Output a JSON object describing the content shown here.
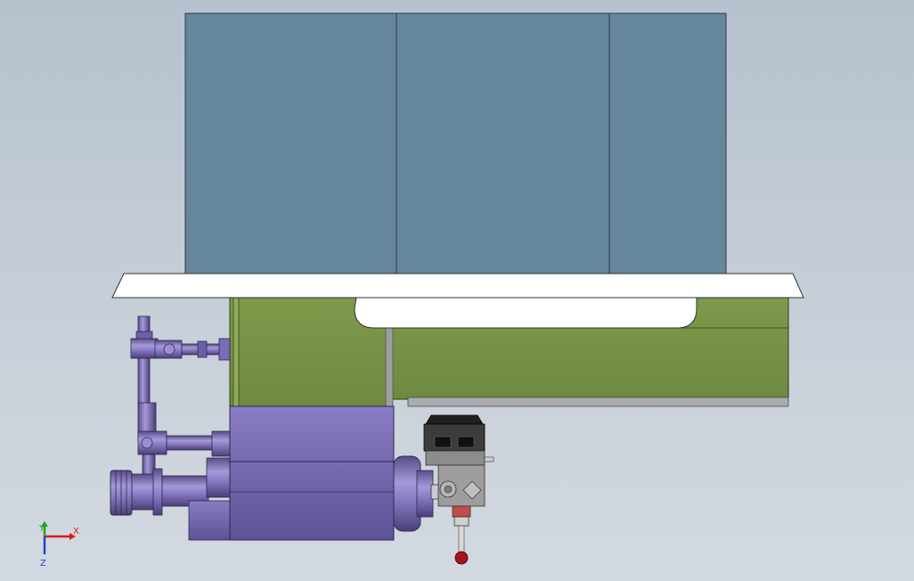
{
  "triad": {
    "x_label": "X",
    "y_label": "Y",
    "z_label": "Z"
  },
  "colors": {
    "background_top": "#b6c1ce",
    "panel_blue": "#66869b",
    "white_plate": "#ffffff",
    "green_frame": "#7f9b4c",
    "motor_purple": "#8576bd",
    "dark_gray": "#505050",
    "axis_x": "#d81c1c",
    "axis_y": "#1aa31a",
    "axis_z": "#1c3fd8"
  }
}
